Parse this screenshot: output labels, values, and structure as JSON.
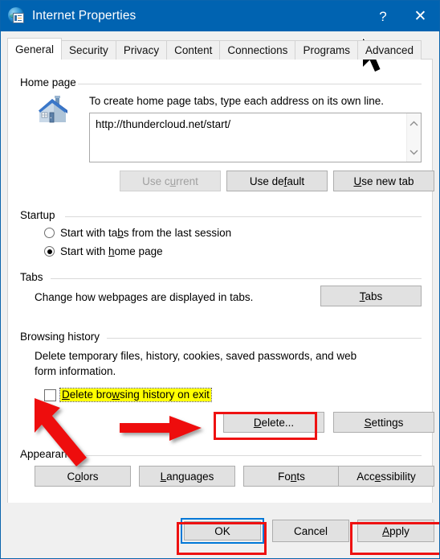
{
  "window": {
    "title": "Internet Properties",
    "icon": "internet-properties-icon",
    "help_label": "?",
    "close_label": "✕"
  },
  "tabs": [
    {
      "label": "General",
      "active": true
    },
    {
      "label": "Security",
      "active": false
    },
    {
      "label": "Privacy",
      "active": false
    },
    {
      "label": "Content",
      "active": false
    },
    {
      "label": "Connections",
      "active": false
    },
    {
      "label": "Programs",
      "active": false
    },
    {
      "label": "Advanced",
      "active": false
    }
  ],
  "home_page": {
    "group_label": "Home page",
    "icon": "house-icon",
    "description": "To create home page tabs, type each address on its own line.",
    "value": "http://thundercloud.net/start/",
    "scroll_up": "⌃",
    "scroll_down": "⌄",
    "buttons": {
      "use_current": "Use current",
      "use_default": "Use default",
      "use_new_tab": "Use new tab"
    }
  },
  "startup": {
    "group_label": "Startup",
    "options": [
      {
        "label": "Start with tabs from the last session",
        "selected": false
      },
      {
        "label": "Start with home page",
        "selected": true
      }
    ]
  },
  "tabs_section": {
    "group_label": "Tabs",
    "description": "Change how webpages are displayed in tabs.",
    "button": "Tabs"
  },
  "browsing_history": {
    "group_label": "Browsing history",
    "description_line1": "Delete temporary files, history, cookies, saved passwords, and web",
    "description_line2": "form information.",
    "checkbox_label": "Delete browsing history on exit",
    "checkbox_checked": false,
    "delete_button": "Delete...",
    "settings_button": "Settings"
  },
  "appearance": {
    "group_label": "Appearance",
    "buttons": [
      "Colors",
      "Languages",
      "Fonts",
      "Accessibility"
    ]
  },
  "dialog_buttons": {
    "ok": "OK",
    "cancel": "Cancel",
    "apply": "Apply"
  },
  "colors": {
    "titlebar": "#0063b1",
    "accent_focus": "#0078d7",
    "annotation_red": "#ee1111",
    "highlight_yellow": "#ffff00",
    "button_face": "#e1e1e1"
  }
}
